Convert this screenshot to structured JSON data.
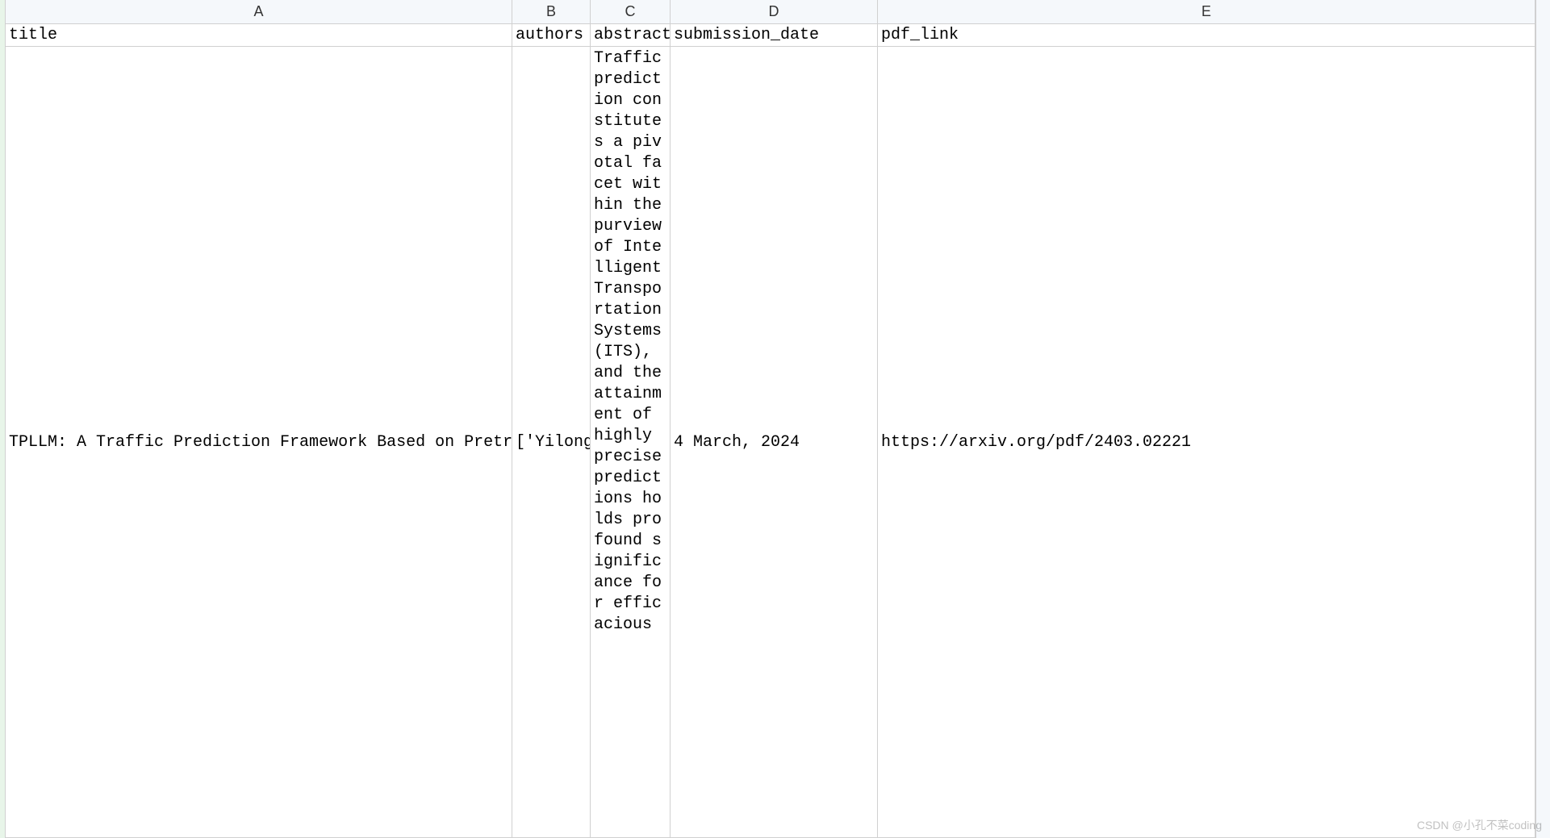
{
  "columns": {
    "A": "A",
    "B": "B",
    "C": "C",
    "D": "D",
    "E": "E"
  },
  "header_row": {
    "A": "title",
    "B": "authors",
    "C": "abstract",
    "D": "submission_date",
    "E": "pdf_link"
  },
  "data_row": {
    "A": "TPLLM: A Traffic Prediction Framework Based on Pretrained Larg",
    "B": "['Yilong F",
    "C": "Traffic prediction constitutes a pivotal facet within the purview of Intelligent Transportation Systems (ITS), and the attainment of highly precise predictions holds profound significance for efficacious",
    "D": "4 March, 2024",
    "E": "https://arxiv.org/pdf/2403.02221"
  },
  "watermark": "CSDN @小孔不菜coding"
}
